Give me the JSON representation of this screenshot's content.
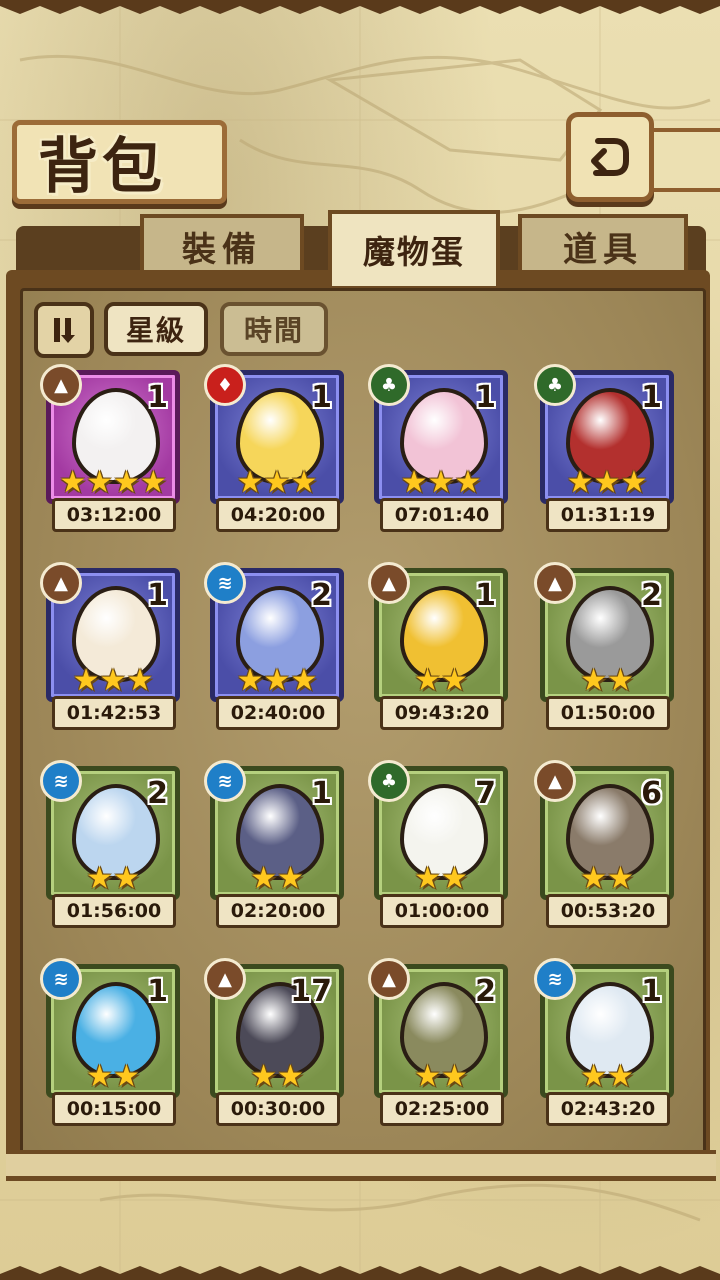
{
  "header": {
    "title": "背包"
  },
  "tabs": [
    {
      "label": "裝備",
      "active": false
    },
    {
      "label": "魔物蛋",
      "active": true
    },
    {
      "label": "道具",
      "active": false
    }
  ],
  "sort": {
    "star": "星級",
    "time": "時間"
  },
  "colors": {
    "earth": "#7a4b2a",
    "fire": "#c9201c",
    "grass": "#2f6a2a",
    "water": "#1f7fc8",
    "star": "#ffc81e"
  },
  "eggs": [
    {
      "element": "earth",
      "count": "1",
      "stars": 4,
      "rarity": "pink",
      "time": "03:12:00",
      "egg_color": "#f3f1f1",
      "icon": "skull-bow-egg"
    },
    {
      "element": "fire",
      "count": "1",
      "stars": 3,
      "rarity": "purple",
      "time": "04:20:00",
      "egg_color": "#f6d65a",
      "icon": "sun-egg"
    },
    {
      "element": "grass",
      "count": "1",
      "stars": 3,
      "rarity": "purple",
      "time": "07:01:40",
      "egg_color": "#f2c3d6",
      "icon": "lotus-egg"
    },
    {
      "element": "grass",
      "count": "1",
      "stars": 3,
      "rarity": "purple",
      "time": "01:31:19",
      "egg_color": "#b3302e",
      "icon": "feather-hat-egg"
    },
    {
      "element": "earth",
      "count": "1",
      "stars": 3,
      "rarity": "purple",
      "time": "01:42:53",
      "egg_color": "#f4ead8",
      "icon": "fluffy-egg"
    },
    {
      "element": "water",
      "count": "2",
      "stars": 3,
      "rarity": "purple",
      "time": "02:40:00",
      "egg_color": "#8c9fe0",
      "icon": "crystal-egg"
    },
    {
      "element": "earth",
      "count": "1",
      "stars": 2,
      "rarity": "green",
      "time": "09:43:20",
      "egg_color": "#f0c032",
      "icon": "gold-slime-egg"
    },
    {
      "element": "earth",
      "count": "2",
      "stars": 2,
      "rarity": "green",
      "time": "01:50:00",
      "egg_color": "#9a9a9a",
      "icon": "feather-egg"
    },
    {
      "element": "water",
      "count": "2",
      "stars": 2,
      "rarity": "green",
      "time": "01:56:00",
      "egg_color": "#bcd6ef",
      "icon": "flask-egg"
    },
    {
      "element": "water",
      "count": "1",
      "stars": 2,
      "rarity": "green",
      "time": "02:20:00",
      "egg_color": "#5b5f86",
      "icon": "shell-egg"
    },
    {
      "element": "grass",
      "count": "7",
      "stars": 2,
      "rarity": "green",
      "time": "01:00:00",
      "egg_color": "#f4f4ee",
      "icon": "turnip-egg"
    },
    {
      "element": "earth",
      "count": "6",
      "stars": 2,
      "rarity": "green",
      "time": "00:53:20",
      "egg_color": "#8a7b6a",
      "icon": "rock-golem-egg"
    },
    {
      "element": "water",
      "count": "1",
      "stars": 2,
      "rarity": "green",
      "time": "00:15:00",
      "egg_color": "#4ab0e4",
      "icon": "spiral-shell-egg"
    },
    {
      "element": "earth",
      "count": "17",
      "stars": 2,
      "rarity": "green",
      "time": "00:30:00",
      "egg_color": "#4c4a58",
      "icon": "witch-hat-egg"
    },
    {
      "element": "earth",
      "count": "2",
      "stars": 2,
      "rarity": "green",
      "time": "02:25:00",
      "egg_color": "#8a8a5e",
      "icon": "seed-egg"
    },
    {
      "element": "water",
      "count": "1",
      "stars": 2,
      "rarity": "green",
      "time": "02:43:20",
      "egg_color": "#dfe9f2",
      "icon": "ice-golem-egg"
    }
  ]
}
